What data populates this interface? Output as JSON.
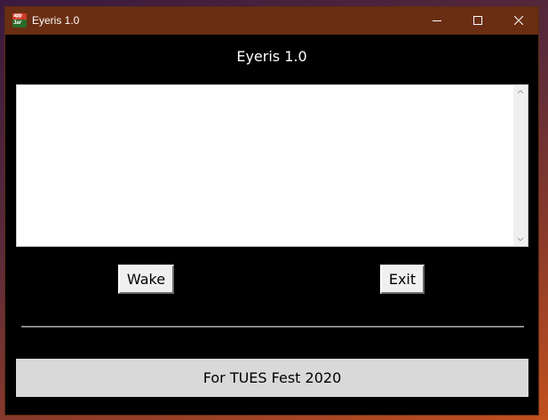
{
  "window": {
    "title": "Eyeris 1.0",
    "icon": {
      "name": "java-app-icon",
      "top_text": "app",
      "bottom_text": "Jar"
    },
    "controls": [
      "minimize-icon",
      "maximize-icon",
      "close-icon"
    ],
    "titlebar_color": "#6a2e13"
  },
  "main": {
    "heading": "Eyeris 1.0",
    "output_text": "",
    "wake_label": "Wake",
    "exit_label": "Exit",
    "footer": "For TUES Fest 2020"
  }
}
